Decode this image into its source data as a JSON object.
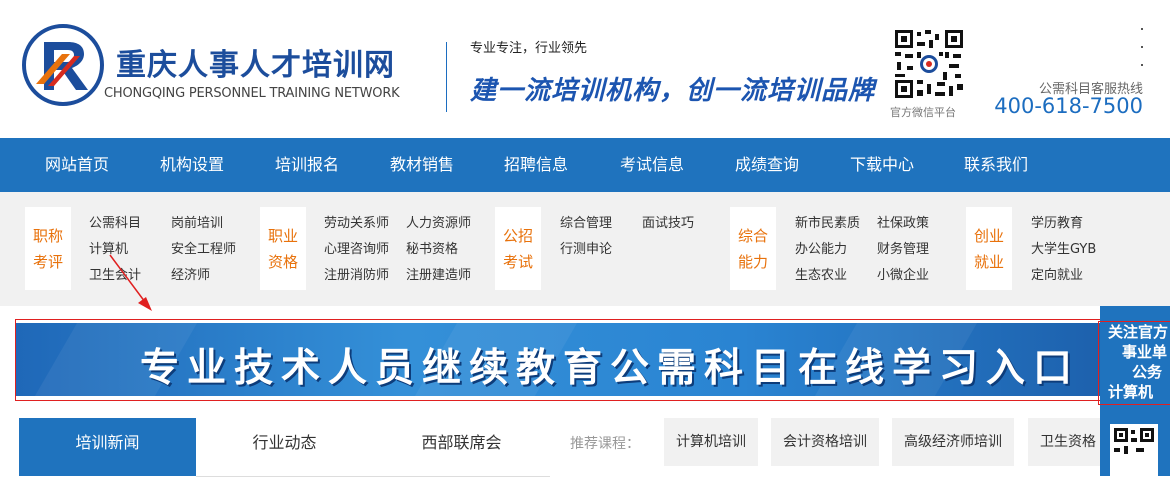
{
  "header": {
    "logo_cn": "重庆人事人才培训网",
    "logo_en": "CHONGQING PERSONNEL TRAINING NETWORK",
    "slogan_small": "专业专注，行业领先",
    "slogan_big": "建一流培训机构，创一流培训品牌",
    "qr_label": "官方微信平台",
    "hotline_label": "公需科目客服热线",
    "hotline_phone": "400-618-7500",
    "brand_colors": {
      "primary": "#1f73be",
      "accent": "#e8720c",
      "logo_red": "#d62b1f"
    }
  },
  "nav": {
    "items": [
      "网站首页",
      "机构设置",
      "培训报名",
      "教材销售",
      "招聘信息",
      "考试信息",
      "成绩查询",
      "下载中心",
      "联系我们"
    ]
  },
  "categories": [
    {
      "title1": "职称",
      "title2": "考评",
      "links": [
        "公需科目",
        "岗前培训",
        "计算机",
        "安全工程师",
        "卫生会计",
        "经济师"
      ]
    },
    {
      "title1": "职业",
      "title2": "资格",
      "links": [
        "劳动关系师",
        "人力资源师",
        "心理咨询师",
        "秘书资格",
        "注册消防师",
        "注册建造师"
      ]
    },
    {
      "title1": "公招",
      "title2": "考试",
      "links": [
        "综合管理",
        "面试技巧",
        "行测申论"
      ]
    },
    {
      "title1": "综合",
      "title2": "能力",
      "links": [
        "新市民素质",
        "社保政策",
        "办公能力",
        "财务管理",
        "生态农业",
        "小微企业"
      ]
    },
    {
      "title1": "创业",
      "title2": "就业",
      "links": [
        "学历教育",
        "大学生GYB",
        "定向就业"
      ]
    }
  ],
  "banner": {
    "text": "专业技术人员继续教育公需科目在线学习入口"
  },
  "tabs": [
    "培训新闻",
    "行业动态",
    "西部联席会"
  ],
  "recommend": {
    "label": "推荐课程：",
    "courses": [
      "计算机培训",
      "会计资格培训",
      "高级经济师培训",
      "卫生资格"
    ]
  },
  "float_panel": {
    "lines": [
      "关注官方",
      "事业单",
      "公务",
      "计算机"
    ]
  }
}
